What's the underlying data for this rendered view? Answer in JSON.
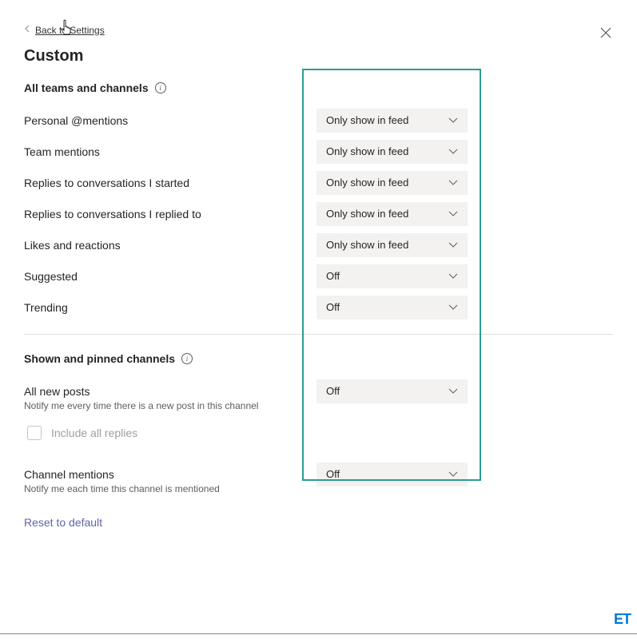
{
  "header": {
    "back_label": "Back to Settings",
    "page_title": "Custom"
  },
  "section1": {
    "heading": "All teams and channels",
    "rows": [
      {
        "label": "Personal @mentions",
        "value": "Only show in feed"
      },
      {
        "label": "Team mentions",
        "value": "Only show in feed"
      },
      {
        "label": "Replies to conversations I started",
        "value": "Only show in feed"
      },
      {
        "label": "Replies to conversations I replied to",
        "value": "Only show in feed"
      },
      {
        "label": "Likes and reactions",
        "value": "Only show in feed"
      },
      {
        "label": "Suggested",
        "value": "Off"
      },
      {
        "label": "Trending",
        "value": "Off"
      }
    ]
  },
  "section2": {
    "heading": "Shown and pinned channels",
    "row1": {
      "label": "All new posts",
      "subtext": "Notify me every time there is a new post in this channel",
      "value": "Off"
    },
    "checkbox_label": "Include all replies",
    "row2": {
      "label": "Channel mentions",
      "subtext": "Notify me each time this channel is mentioned",
      "value": "Off"
    }
  },
  "reset_label": "Reset to default",
  "footer_logo": "ET"
}
